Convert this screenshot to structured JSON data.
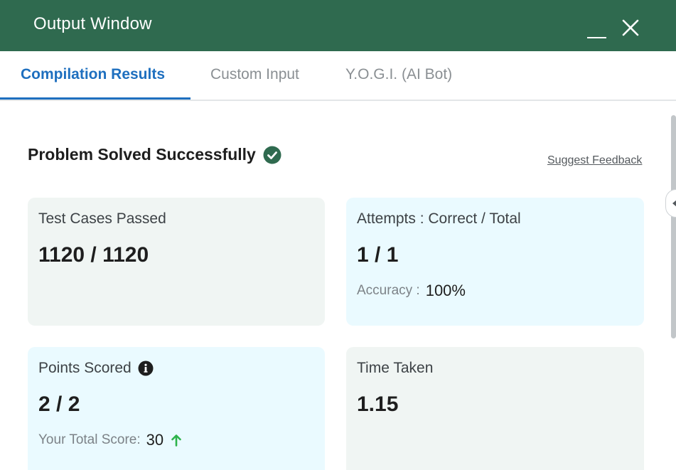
{
  "window": {
    "title": "Output Window"
  },
  "tabs": [
    {
      "label": "Compilation Results",
      "active": true
    },
    {
      "label": "Custom Input",
      "active": false
    },
    {
      "label": "Y.O.G.I. (AI Bot)",
      "active": false
    }
  ],
  "status": {
    "text": "Problem Solved Successfully",
    "icon": "check-circle-icon"
  },
  "feedback_link": "Suggest Feedback",
  "cards": {
    "test_cases": {
      "label": "Test Cases Passed",
      "value": "1120 / 1120"
    },
    "attempts": {
      "label": "Attempts : Correct / Total",
      "value": "1 / 1",
      "accuracy_label": "Accuracy :",
      "accuracy_value": "100%"
    },
    "points": {
      "label": "Points Scored",
      "value": "2 / 2",
      "total_label": "Your Total Score:",
      "total_value": "30"
    },
    "time": {
      "label": "Time Taken",
      "value": "1.15"
    }
  },
  "colors": {
    "titlebar": "#2f6a4f",
    "accent": "#1e6fbf",
    "success": "#2f6a4f",
    "card_gray": "#f0f5f3",
    "card_cyan": "#eafaff",
    "arrow_up": "#2db34a"
  }
}
